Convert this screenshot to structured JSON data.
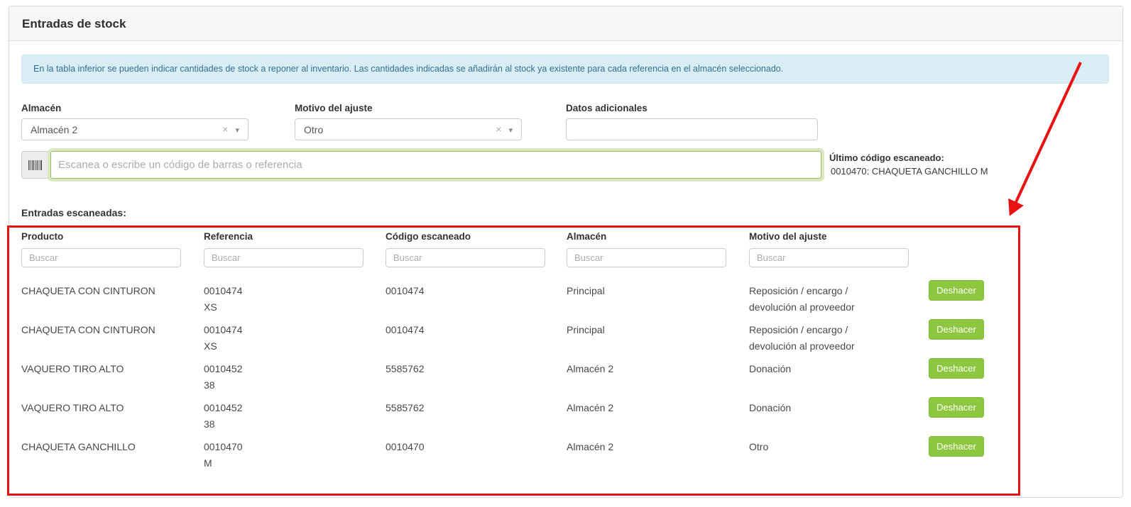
{
  "page": {
    "title": "Entradas de stock"
  },
  "banner": {
    "text": "En la tabla inferior se pueden indicar cantidades de stock a reponer al inventario. Las cantidades indicadas se añadirán al stock ya existente para cada referencia en el almacén seleccionado."
  },
  "form": {
    "almacen": {
      "label": "Almacén",
      "value": "Almacén 2"
    },
    "motivo": {
      "label": "Motivo del ajuste",
      "value": "Otro"
    },
    "datos": {
      "label": "Datos adicionales",
      "value": ""
    }
  },
  "scanner": {
    "placeholder": "Escanea o escribe un código de barras o referencia",
    "last_label": "Último código escaneado:",
    "last_value": "0010470: CHAQUETA GANCHILLO M"
  },
  "entries": {
    "title": "Entradas escaneadas:",
    "filter_placeholder": "Buscar",
    "columns": [
      "Producto",
      "Referencia",
      "Código escaneado",
      "Almacén",
      "Motivo del ajuste"
    ],
    "undo_label": "Deshacer",
    "rows": [
      {
        "producto": "CHAQUETA CON CINTURON",
        "ref": "0010474",
        "talla": "XS",
        "codigo": "0010474",
        "almacen": "Principal",
        "motivo": "Reposición / encargo / devolución al proveedor"
      },
      {
        "producto": "CHAQUETA CON CINTURON",
        "ref": "0010474",
        "talla": "XS",
        "codigo": "0010474",
        "almacen": "Principal",
        "motivo": "Reposición / encargo / devolución al proveedor"
      },
      {
        "producto": "VAQUERO TIRO ALTO",
        "ref": "0010452",
        "talla": "38",
        "codigo": "5585762",
        "almacen": "Almacén 2",
        "motivo": "Donación"
      },
      {
        "producto": "VAQUERO TIRO ALTO",
        "ref": "0010452",
        "talla": "38",
        "codigo": "5585762",
        "almacen": "Almacén 2",
        "motivo": "Donación"
      },
      {
        "producto": "CHAQUETA GANCHILLO",
        "ref": "0010470",
        "talla": "M",
        "codigo": "0010470",
        "almacen": "Almacén 2",
        "motivo": "Otro"
      }
    ]
  },
  "colors": {
    "accent_green": "#8dc63f",
    "scanner_border_green": "#97c05c",
    "banner_bg": "#d9edf5",
    "annotation_red": "#e81212",
    "header_bg": "#f7f7f7"
  }
}
